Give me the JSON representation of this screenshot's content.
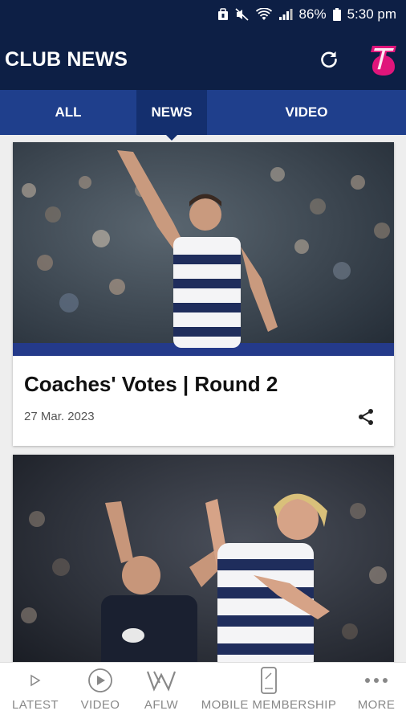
{
  "status_bar": {
    "battery": "86%",
    "time": "5:30 pm"
  },
  "header": {
    "title": "CLUB NEWS",
    "refresh_icon": "refresh-icon",
    "brand_icon": "telstra-logo-icon"
  },
  "tabs": [
    {
      "label": "ALL",
      "active": false
    },
    {
      "label": "NEWS",
      "active": true
    },
    {
      "label": "VIDEO",
      "active": false
    }
  ],
  "articles": [
    {
      "headline": "Coaches' Votes | Round 2",
      "date": "27 Mar. 2023",
      "share_icon": "share-icon"
    },
    {
      "headline": "",
      "date": ""
    }
  ],
  "bottom_nav": [
    {
      "label": "LATEST",
      "icon": "play-triangle-icon"
    },
    {
      "label": "VIDEO",
      "icon": "play-circle-icon"
    },
    {
      "label": "AFLW",
      "icon": "aflw-logo-icon"
    },
    {
      "label": "MOBILE MEMBERSHIP",
      "icon": "phone-icon"
    },
    {
      "label": "MORE",
      "icon": "more-dots-icon"
    }
  ],
  "colors": {
    "header_bg": "#0d1f45",
    "tab_bg": "#1f3f8c",
    "tab_active_bg": "#142f6e",
    "telstra_magenta": "#e0157b",
    "nav_label": "#888888"
  }
}
